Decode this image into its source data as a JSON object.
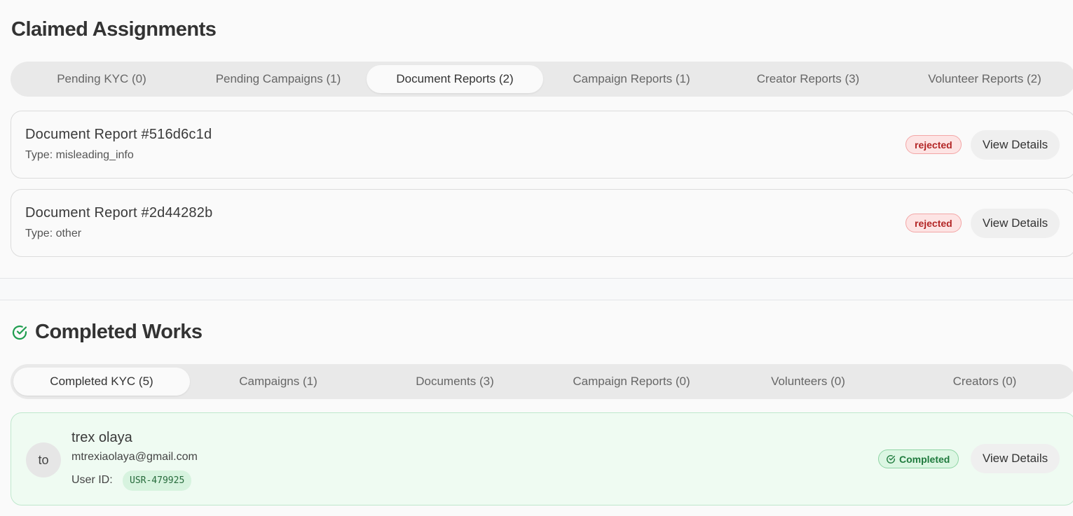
{
  "claimed": {
    "title": "Claimed Assignments",
    "tabs": [
      {
        "label": "Pending KYC (0)",
        "active": false
      },
      {
        "label": "Pending Campaigns (1)",
        "active": false
      },
      {
        "label": "Document Reports (2)",
        "active": true
      },
      {
        "label": "Campaign Reports (1)",
        "active": false
      },
      {
        "label": "Creator Reports (3)",
        "active": false
      },
      {
        "label": "Volunteer Reports (2)",
        "active": false
      }
    ],
    "reports": [
      {
        "title": "Document Report #516d6c1d",
        "type": "Type: misleading_info",
        "status": "rejected",
        "action": "View Details"
      },
      {
        "title": "Document Report #2d44282b",
        "type": "Type: other",
        "status": "rejected",
        "action": "View Details"
      }
    ]
  },
  "completed": {
    "title": "Completed Works",
    "icon": "check-circle-icon",
    "tabs": [
      {
        "label": "Completed KYC (5)",
        "active": true
      },
      {
        "label": "Campaigns (1)",
        "active": false
      },
      {
        "label": "Documents (3)",
        "active": false
      },
      {
        "label": "Campaign Reports (0)",
        "active": false
      },
      {
        "label": "Volunteers (0)",
        "active": false
      },
      {
        "label": "Creators (0)",
        "active": false
      }
    ],
    "items": [
      {
        "avatar_initials": "to",
        "name": "trex olaya",
        "email": "mtrexiaolaya@gmail.com",
        "user_id_label": "User ID:",
        "user_id": "USR-479925",
        "status": "Completed",
        "action": "View Details"
      }
    ]
  },
  "colors": {
    "accent_green": "#1f9d4f",
    "rejected_red": "#b32626"
  }
}
